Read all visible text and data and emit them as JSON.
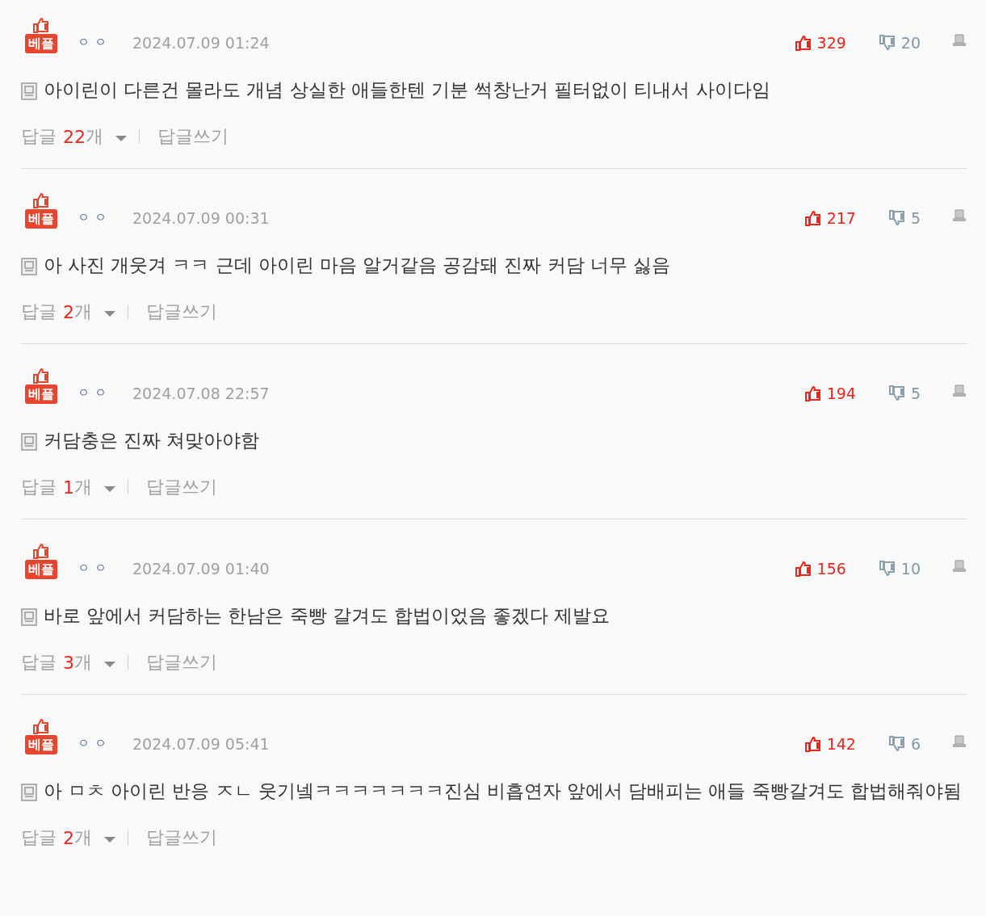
{
  "comments": [
    {
      "badge": "베플",
      "nickname": "ㅇㅇ",
      "date": "2024.07.09 01:24",
      "likes": "329",
      "dislikes": "20",
      "text": "아이린이 다른건 몰라도 개념 상실한 애들한텐 기분 썩창난거 필터없이 티내서 사이다임",
      "reply_label": "답글",
      "reply_count": "22",
      "reply_unit": "개",
      "write_reply": "답글쓰기"
    },
    {
      "badge": "베플",
      "nickname": "ㅇㅇ",
      "date": "2024.07.09 00:31",
      "likes": "217",
      "dislikes": "5",
      "text": "아 사진 개웃겨 ㅋㅋ 근데 아이린 마음 알거같음 공감돼 진짜 커담 너무 싫음",
      "reply_label": "답글",
      "reply_count": "2",
      "reply_unit": "개",
      "write_reply": "답글쓰기"
    },
    {
      "badge": "베플",
      "nickname": "ㅇㅇ",
      "date": "2024.07.08 22:57",
      "likes": "194",
      "dislikes": "5",
      "text": "커담충은 진짜 쳐맞아야함",
      "reply_label": "답글",
      "reply_count": "1",
      "reply_unit": "개",
      "write_reply": "답글쓰기"
    },
    {
      "badge": "베플",
      "nickname": "ㅇㅇ",
      "date": "2024.07.09 01:40",
      "likes": "156",
      "dislikes": "10",
      "text": "바로 앞에서 커담하는 한남은 죽빵 갈겨도 합법이었음 좋겠다 제발요",
      "reply_label": "답글",
      "reply_count": "3",
      "reply_unit": "개",
      "write_reply": "답글쓰기"
    },
    {
      "badge": "베플",
      "nickname": "ㅇㅇ",
      "date": "2024.07.09 05:41",
      "likes": "142",
      "dislikes": "6",
      "text": "아 ㅁㅊ 아이린 반응 ㅈㄴ 웃기넼ㅋㅋㅋㅋㅋㅋㅋ진심 비흡연자 앞에서 담배피는 애들 죽빵갈겨도 합법해줘야됨",
      "reply_label": "답글",
      "reply_count": "2",
      "reply_unit": "개",
      "write_reply": "답글쓰기"
    }
  ]
}
